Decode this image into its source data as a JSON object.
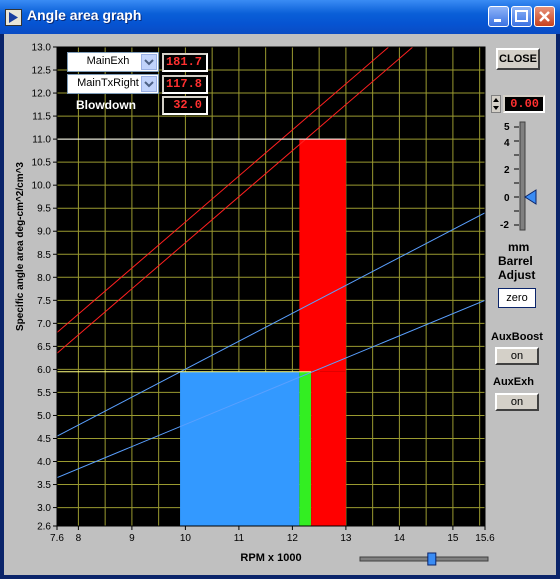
{
  "window": {
    "title": "Angle area graph"
  },
  "controls": {
    "close_label": "CLOSE",
    "selector1": {
      "selected": "MainExh",
      "value": "181.7"
    },
    "selector2": {
      "selected": "MainTxRight",
      "value": "117.8"
    },
    "blowdown": {
      "label": "Blowdown",
      "value": "32.0"
    }
  },
  "barrel_adjust": {
    "value": "0.00",
    "unit": "mm",
    "label1": "Barrel",
    "label2": "Adjust",
    "zero_label": "zero",
    "scale_labels": [
      "5",
      "4",
      "2",
      "0",
      "-2"
    ],
    "slider_value": 0
  },
  "aux_boost": {
    "label": "AuxBoost",
    "state": "on"
  },
  "aux_exh": {
    "label": "AuxExh",
    "state": "on"
  },
  "chart_data": {
    "type": "area",
    "xlabel": "RPM x 1000",
    "ylabel": "Specific angle area  deg-cm^2/cm^3",
    "xlim": [
      7.6,
      15.6
    ],
    "ylim": [
      2.6,
      13.0
    ],
    "x_ticks": [
      "7.6",
      "8",
      "9",
      "10",
      "11",
      "12",
      "13",
      "14",
      "15",
      "15.6"
    ],
    "y_ticks": [
      "2.6",
      "3.0",
      "3.5",
      "4.0",
      "4.5",
      "5.0",
      "5.5",
      "6.0",
      "6.5",
      "7.0",
      "7.5",
      "8.0",
      "8.5",
      "9.0",
      "9.5",
      "10.0",
      "10.5",
      "11.0",
      "11.5",
      "12.0",
      "12.5",
      "13.0"
    ],
    "grid": true,
    "regions": [
      {
        "name": "blue",
        "color": "#3399ff",
        "x": [
          9.9,
          12.13
        ],
        "y": [
          2.6,
          5.95
        ]
      },
      {
        "name": "green",
        "color": "#33ee22",
        "x": [
          12.13,
          12.35
        ],
        "y": [
          2.6,
          5.95
        ]
      },
      {
        "name": "red",
        "color": "#ff0000",
        "x": [
          12.35,
          13.0
        ],
        "y": [
          2.6,
          5.95
        ]
      },
      {
        "name": "red-upper",
        "color": "#ff0000",
        "x": [
          12.13,
          13.0
        ],
        "y": [
          5.95,
          11.0
        ]
      }
    ],
    "lines": [
      {
        "color": "#ff2020",
        "points": [
          [
            7.6,
            6.8
          ],
          [
            15.6,
            14.8
          ]
        ]
      },
      {
        "color": "#ff2020",
        "points": [
          [
            7.6,
            6.35
          ],
          [
            15.6,
            14.35
          ]
        ]
      },
      {
        "color": "#5aa0ff",
        "points": [
          [
            7.6,
            4.55
          ],
          [
            15.6,
            9.4
          ]
        ]
      },
      {
        "color": "#5aa0ff",
        "points": [
          [
            7.6,
            3.65
          ],
          [
            15.6,
            7.5
          ]
        ]
      }
    ],
    "hlines": [
      {
        "color": "#ffffff",
        "y": 11.0,
        "x": [
          7.6,
          13.0
        ]
      },
      {
        "color": "#ffff80",
        "y": 5.95,
        "x": [
          7.6,
          12.35
        ]
      }
    ],
    "rpm_slider_value": 12.13
  }
}
